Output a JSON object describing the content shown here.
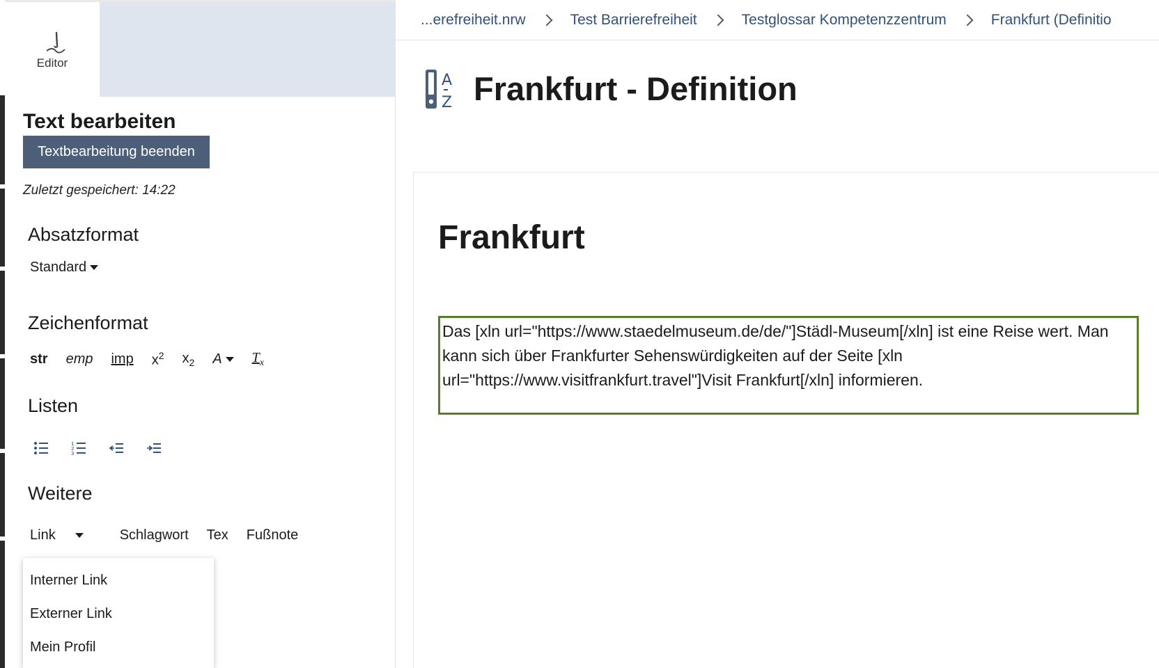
{
  "sidebar": {
    "editor_tab": {
      "label": "Editor",
      "icon": "pen-icon"
    },
    "title": "Text bearbeiten",
    "finish_button": "Textbearbeitung beenden",
    "saved_status": "Zuletzt gespeichert: 14:22",
    "paragraph": {
      "heading": "Absatzformat",
      "selected": "Standard"
    },
    "character": {
      "heading": "Zeichenformat",
      "str": "str",
      "emp": "emp",
      "imp": "imp",
      "sup_base": "x",
      "sup_exp": "2",
      "sub_base": "x",
      "sub_idx": "2",
      "font_color": "A",
      "clear_base": "T",
      "clear_sub": "x"
    },
    "lists": {
      "heading": "Listen",
      "icons": [
        "bullet-list-icon",
        "numbered-list-icon",
        "outdent-icon",
        "indent-icon"
      ]
    },
    "more": {
      "heading": "Weitere",
      "link": "Link",
      "keyword": "Schlagwort",
      "tex": "Tex",
      "footnote": "Fußnote"
    },
    "link_menu": {
      "items": [
        "Interner Link",
        "Externer Link",
        "Mein Profil"
      ]
    }
  },
  "breadcrumb": {
    "items": [
      "...erefreiheit.nrw",
      "Test Barrierefreiheit",
      "Testglossar Kompetenzzentrum",
      "Frankfurt (Definitio"
    ]
  },
  "page": {
    "title": "Frankfurt - Definition",
    "icon": "glossary-az-icon",
    "heading": "Frankfurt",
    "body_text": "Das [xln url=\"https://www.staedelmuseum.de/de/\"]Städl-Museum[/xln] ist eine Reise wert. Man kann sich über Frankfurter Sehenswürdigkeiten auf der Seite [xln url=\"https://www.visitfrankfurt.travel\"]Visit Frankfurt[/xln] informieren."
  },
  "colors": {
    "accent_button": "#4c5e78",
    "breadcrumb_link": "#33507a",
    "editor_border": "#5a7d2c",
    "top_panel_bg": "#dfe5ee"
  }
}
